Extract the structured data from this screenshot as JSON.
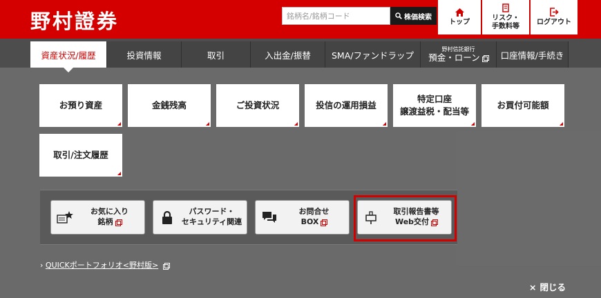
{
  "header": {
    "logo": "野村證券",
    "search": {
      "placeholder": "銘柄名/銘柄コード",
      "button": "株価検索"
    },
    "buttons": {
      "top": "トップ",
      "risk_line1": "リスク・",
      "risk_line2": "手数料等",
      "logout": "ログアウト"
    }
  },
  "nav": {
    "items": [
      "資産状況/履歴",
      "投資情報",
      "取引",
      "入出金/振替",
      "SMA/ファンドラップ"
    ],
    "bank_small": "野村信託銀行",
    "bank_main": "預金・ローン",
    "account": "口座情報/手続き"
  },
  "tiles": {
    "t1": "お預り資産",
    "t2": "金銭残高",
    "t3": "ご投資状況",
    "t4": "投信の運用損益",
    "t5_line1": "特定口座",
    "t5_line2": "譲渡益税・配当等",
    "t6": "お買付可能額",
    "t7": "取引/注文履歴"
  },
  "panel": {
    "fav_line1": "お気に入り",
    "fav_line2": "銘柄",
    "pw_line1": "パスワード・",
    "pw_line2": "セキュリティ関連",
    "inq_line1": "お問合せ",
    "inq_line2": "BOX",
    "report_line1": "取引報告書等",
    "report_line2": "Web交付"
  },
  "quick": {
    "arrow": "›",
    "label": "QUICKポートフォリオ<野村版>"
  },
  "close": {
    "x": "×",
    "label": "閉じる"
  },
  "colors": {
    "brand": "#d40000",
    "nav": "#4d4d4d",
    "overlay": "#6a6a6a"
  }
}
